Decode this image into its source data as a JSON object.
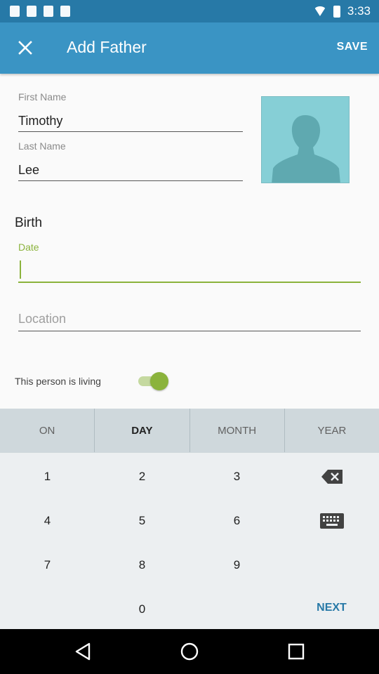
{
  "status_bar": {
    "time": "3:33",
    "icons": [
      "notification-icon",
      "notification-icon",
      "notification-icon",
      "notification-icon"
    ]
  },
  "app_bar": {
    "title": "Add Father",
    "save_label": "SAVE",
    "close_icon": "close-icon"
  },
  "form": {
    "first_name": {
      "label": "First Name",
      "value": "Timothy"
    },
    "last_name": {
      "label": "Last Name",
      "value": "Lee"
    },
    "photo_icon": "person-silhouette-icon",
    "birth": {
      "title": "Birth",
      "date": {
        "label": "Date",
        "value": ""
      },
      "location": {
        "placeholder": "Location",
        "value": ""
      }
    },
    "living": {
      "label": "This person is living",
      "on": true
    }
  },
  "date_picker": {
    "tabs": [
      {
        "label": "ON",
        "active": false
      },
      {
        "label": "DAY",
        "active": true
      },
      {
        "label": "MONTH",
        "active": false
      },
      {
        "label": "YEAR",
        "active": false
      }
    ],
    "keys": [
      "1",
      "2",
      "3",
      "4",
      "5",
      "6",
      "7",
      "8",
      "9",
      "0"
    ],
    "next_label": "NEXT"
  },
  "colors": {
    "app_bar": "#3a94c4",
    "status_bar": "#2779a7",
    "accent": "#8bb33c",
    "photo_bg": "#86cfd6"
  }
}
